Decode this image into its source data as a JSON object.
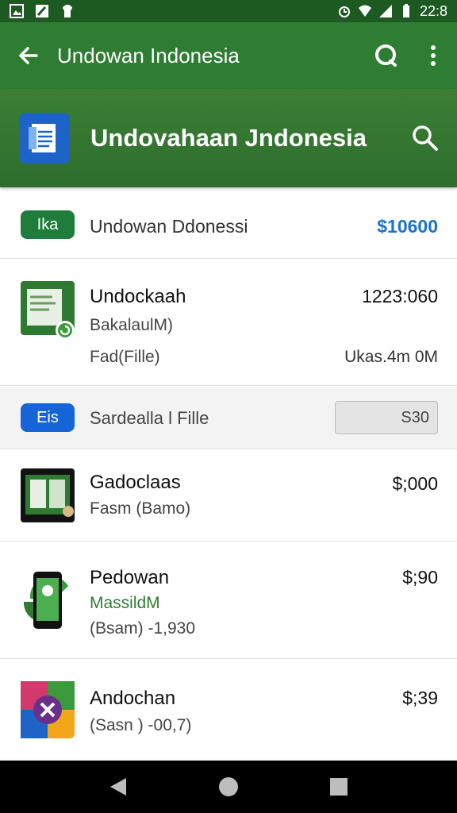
{
  "status_bar": {
    "time": "22:8"
  },
  "toolbar": {
    "title": "Undowan Indonesia"
  },
  "banner": {
    "title": "Undovahaan Jndonesia"
  },
  "header_row": {
    "badge": "Ika",
    "label": "Undowan Ddonessi",
    "price": "$10600"
  },
  "item_1": {
    "name": "Undockaah",
    "subtitle": "BakalaulM)",
    "detail": "Fad(Fille)",
    "price": "1223:060",
    "size": "Ukas.4m 0M"
  },
  "filter_row": {
    "badge": "Eis",
    "label": "Sardealla l Fille",
    "value": "S30"
  },
  "item_2": {
    "name": "Gadoclaas",
    "subtitle": "Fasm (Bamo)",
    "price": "$;000"
  },
  "item_3": {
    "name": "Pedowan",
    "subtitle": "MassildM",
    "detail": "(Bsam) -1,930",
    "price": "$;90"
  },
  "item_4": {
    "name": "Andochan",
    "subtitle": "(Sasn ) -00,7)",
    "price": "$;39"
  },
  "colors": {
    "toolbar": "#2e7d32",
    "status_bar": "#1d5a22",
    "accent_blue": "#1a73c7",
    "pill_green": "#1e7d3a",
    "pill_blue": "#1565d8"
  },
  "icons": [
    "back-arrow-icon",
    "chat-icon",
    "more-vert-icon",
    "document-icon",
    "search-icon",
    "back-nav-icon",
    "home-nav-icon",
    "recents-nav-icon"
  ]
}
